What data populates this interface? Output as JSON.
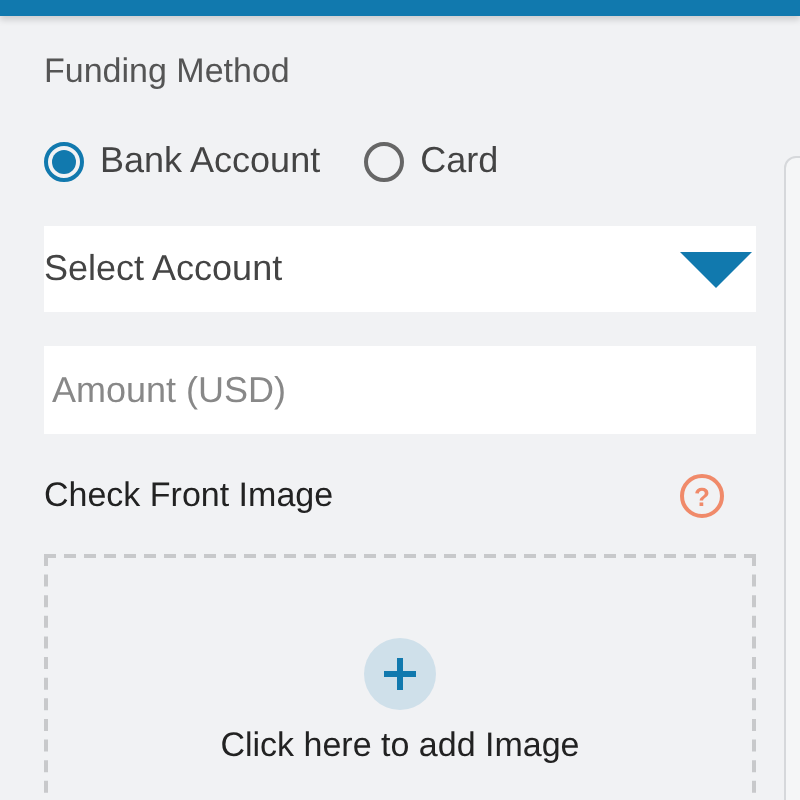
{
  "funding_method": {
    "label": "Funding Method",
    "options": [
      {
        "label": "Bank Account",
        "selected": true
      },
      {
        "label": "Card",
        "selected": false
      }
    ]
  },
  "account_select": {
    "value": "Select Account"
  },
  "amount": {
    "placeholder": "Amount (USD)"
  },
  "check_front": {
    "label": "Check Front Image",
    "help": "?",
    "upload_text": "Click here to add Image"
  }
}
